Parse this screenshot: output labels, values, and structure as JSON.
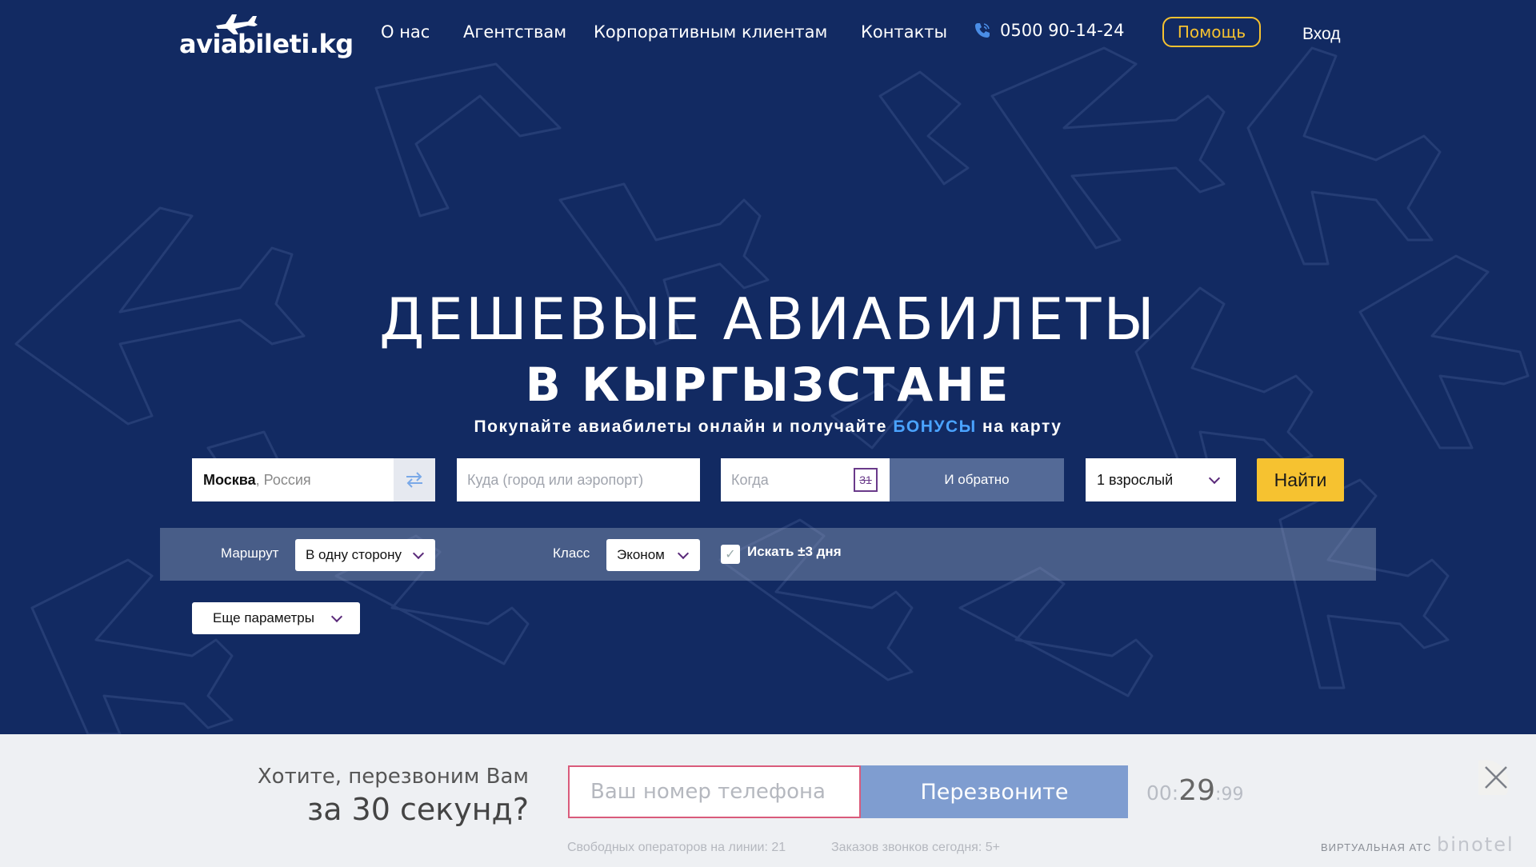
{
  "header": {
    "logo_text": "aviabileti.kg",
    "nav": [
      "О нас",
      "Агентствам",
      "Корпоративным клиентам",
      "Контакты"
    ],
    "phone": "0500 90-14-24",
    "help_label": "Помощь",
    "login_label": "Вход"
  },
  "hero": {
    "title_line1": "ДЕШЕВЫЕ АВИАБИЛЕТЫ",
    "title_line2": "В КЫРГЫЗСТАНЕ",
    "subtitle_pre": "Покупайте авиабилеты онлайн и получайте ",
    "subtitle_accent": "БОНУСЫ",
    "subtitle_post": " на карту"
  },
  "search": {
    "from_city": "Москва",
    "from_country": ", Россия",
    "to_placeholder": "Куда (город или аэропорт)",
    "when_placeholder": "Когда",
    "calendar_day": "31",
    "return_label": "И обратно",
    "passengers": "1 взрослый",
    "search_label": "Найти"
  },
  "options": {
    "route_label": "Маршрут",
    "route_value": "В одну сторону",
    "class_label": "Класс",
    "class_value": "Эконом",
    "flex_dates_label": "Искать ±3 дня",
    "more_params_label": "Еще параметры"
  },
  "callback": {
    "question_line1": "Хотите, перезвоним Вам",
    "question_line2": "за 30 секунд?",
    "phone_placeholder": "Ваш номер телефона",
    "button_label": "Перезвоните",
    "timer_min": "00:",
    "timer_sec": "29",
    "timer_ms": ":99",
    "free_operators": "Свободных операторов на линии: 21",
    "orders_today": "Заказов звонков сегодня: 5+",
    "vats_label": "ВИРТУАЛЬНАЯ АТС",
    "brand": "binotel"
  },
  "colors": {
    "background": "#12295f",
    "accent_yellow": "#f6c230",
    "bonus_blue": "#4aa3ff",
    "callback_button": "#7f9dd0",
    "callback_input_border": "#d95b7b"
  },
  "icons": [
    "plane-logo-icon",
    "phone-icon",
    "swap-icon",
    "calendar-icon",
    "chevron-down-icon",
    "checkmark-icon",
    "close-icon"
  ]
}
